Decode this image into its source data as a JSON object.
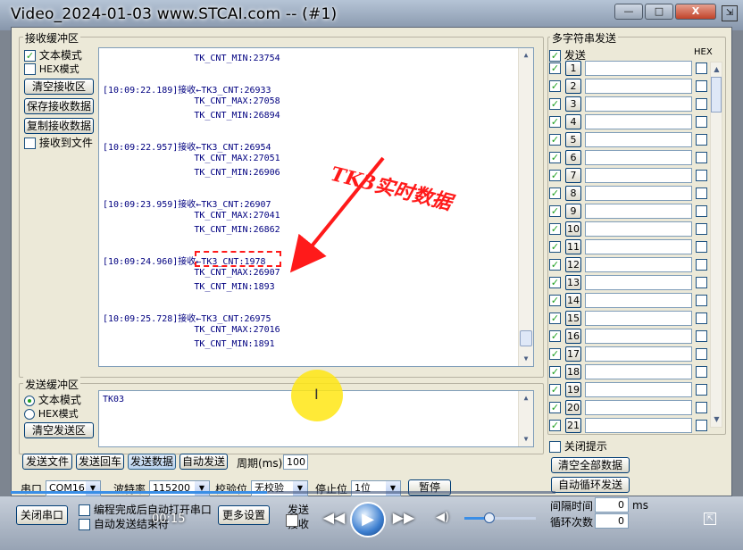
{
  "window": {
    "title": "Video_2024-01-03 www.STCAI.com -- (#1)",
    "buttons": [
      "—",
      "□",
      "X"
    ]
  },
  "receive": {
    "group_title": "接收缓冲区",
    "text_mode": "文本模式",
    "hex_mode": "HEX模式",
    "clear_btn": "清空接收区",
    "save_btn": "保存接收数据",
    "copy_btn": "复制接收数据",
    "to_file": "接收到文件",
    "lines": [
      "                 TK_CNT_MIN:23754",
      "",
      "[10:09:22.189]接收←TK3_CNT:26933",
      "                 TK_CNT_MAX:27058",
      "                 TK_CNT_MIN:26894",
      "",
      "[10:09:22.957]接收←TK3_CNT:26954",
      "                 TK_CNT_MAX:27051",
      "                 TK_CNT_MIN:26906",
      "",
      "[10:09:23.959]接收←TK3_CNT:26907",
      "                 TK_CNT_MAX:27041",
      "                 TK_CNT_MIN:26862",
      "",
      "[10:09:24.960]接收←TK3_CNT:1978",
      "                 TK_CNT_MAX:26907",
      "                 TK_CNT_MIN:1893",
      "",
      "[10:09:25.728]接收←TK3_CNT:26975",
      "                 TK_CNT_MAX:27016",
      "                 TK_CNT_MIN:1891"
    ],
    "annotation": "TK3实时数据"
  },
  "send": {
    "group_title": "发送缓冲区",
    "text_mode": "文本模式",
    "hex_mode": "HEX模式",
    "clear_btn": "清空发送区",
    "content": "TK03"
  },
  "bottom_buttons": {
    "send_file": "发送文件",
    "send_return": "发送回车",
    "send_data": "发送数据",
    "auto_send": "自动发送",
    "period_label": "周期(ms)",
    "period_value": "100"
  },
  "serial": {
    "port_label": "串口",
    "port_value": "COM16",
    "baud_label": "波特率",
    "baud_value": "115200",
    "parity_label": "校验位",
    "parity_value": "无校验",
    "stop_label": "停止位",
    "stop_value": "1位",
    "pause_btn": "暂停"
  },
  "multi": {
    "group_title": "多字符串发送",
    "send_col": "发送",
    "hex_col": "HEX",
    "rows": [
      "1",
      "2",
      "3",
      "4",
      "5",
      "6",
      "7",
      "8",
      "9",
      "10",
      "11",
      "12",
      "13",
      "14",
      "15",
      "16",
      "17",
      "18",
      "19",
      "20",
      "21"
    ],
    "close_tip": "关闭提示",
    "clear_all": "清空全部数据",
    "auto_loop": "自动循环发送",
    "interval_label": "间隔时间",
    "interval_value": "0",
    "interval_unit": "ms",
    "loop_label": "循环次数",
    "loop_value": "0"
  },
  "lowerbar": {
    "close_port": "关闭串口",
    "auto_open": "编程完成后自动打开串口",
    "auto_send_end": "自动发送结束符",
    "more_settings": "更多设置",
    "send_label": "发送",
    "recv_label": "接收"
  },
  "player": {
    "time": "00:15",
    "progress": 0.47,
    "volume": 0.35
  }
}
